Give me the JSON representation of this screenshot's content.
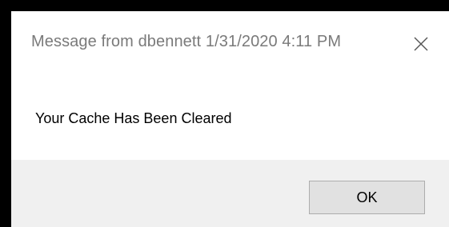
{
  "dialog": {
    "title": "Message from dbennett 1/31/2020 4:11 PM",
    "message": "Your Cache Has Been Cleared",
    "ok_label": "OK",
    "close_icon": "close-icon"
  },
  "colors": {
    "frame_border": "#000000",
    "title_text": "#7a7a7a",
    "footer_background": "#f0f0f0",
    "button_background": "#e1e1e1",
    "button_border": "#adadad"
  }
}
